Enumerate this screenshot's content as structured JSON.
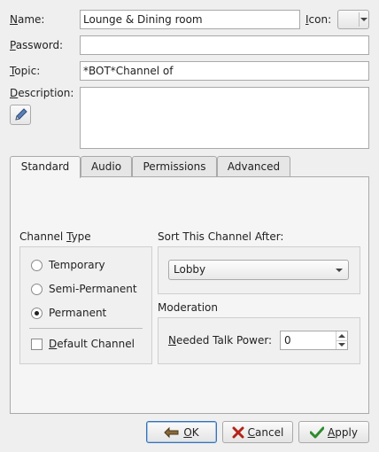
{
  "form": {
    "name_label_u": "N",
    "name_label_rest": "ame:",
    "name_value": "Lounge & Dining room",
    "icon_label_u": "I",
    "icon_label_rest": "con:",
    "password_label_u": "P",
    "password_label_rest": "assword:",
    "password_value": "",
    "topic_label_u": "T",
    "topic_label_rest": "opic:",
    "topic_value": "*BOT*Channel of",
    "description_label_u": "D",
    "description_label_rest": "escription:",
    "description_value": ""
  },
  "tabs": [
    {
      "label": "Standard",
      "active": true
    },
    {
      "label": "Audio"
    },
    {
      "label": "Permissions"
    },
    {
      "label": "Advanced"
    }
  ],
  "channel_type": {
    "title_pre": "Channel ",
    "title_u": "T",
    "title_post": "ype",
    "options": [
      "Temporary",
      "Semi-Permanent",
      "Permanent"
    ],
    "selected": "Permanent",
    "default_u": "D",
    "default_rest": "efault Channel",
    "default_checked": false
  },
  "sort": {
    "title": "Sort This Channel After:",
    "value": "Lobby"
  },
  "moderation": {
    "title": "Moderation",
    "talk_power_u": "N",
    "talk_power_rest": "eeded Talk Power:",
    "talk_power_value": "0"
  },
  "buttons": {
    "ok_u": "O",
    "ok_rest": "K",
    "cancel_u": "C",
    "cancel_rest": "ancel",
    "apply_u": "A",
    "apply_rest": "pply"
  },
  "colors": {
    "accent": "#3a72b0",
    "cancel_x": "#b42318",
    "apply_check": "#2e8b2e"
  },
  "icons": {
    "description_edit": "pencil-icon",
    "ok": "ok-hand-icon",
    "cancel": "x-icon",
    "apply": "checkmark-icon"
  }
}
